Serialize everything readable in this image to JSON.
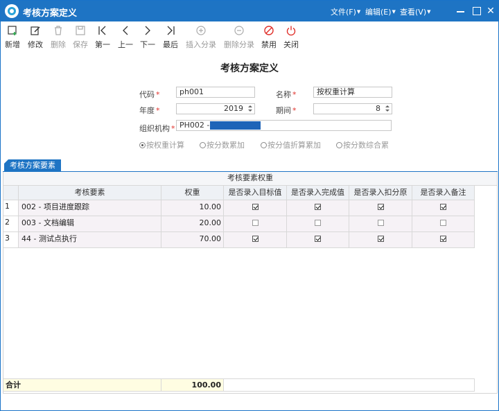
{
  "window": {
    "title": "考核方案定义",
    "menus": [
      {
        "label": "文件(F)"
      },
      {
        "label": "编辑(E)"
      },
      {
        "label": "查看(V)"
      }
    ],
    "minimize_glyph": "—",
    "close_glyph": "✕"
  },
  "toolbar": [
    {
      "label": "新增",
      "icon": "add-icon",
      "enabled": true
    },
    {
      "label": "修改",
      "icon": "edit-icon",
      "enabled": true
    },
    {
      "label": "删除",
      "icon": "trash-icon",
      "enabled": false
    },
    {
      "label": "保存",
      "icon": "save-icon",
      "enabled": false
    },
    {
      "label": "第一",
      "icon": "first-icon",
      "enabled": true
    },
    {
      "label": "上一",
      "icon": "prev-icon",
      "enabled": true
    },
    {
      "label": "下一",
      "icon": "next-icon",
      "enabled": true
    },
    {
      "label": "最后",
      "icon": "last-icon",
      "enabled": true
    },
    {
      "label": "插入分录",
      "icon": "insert-row-icon",
      "enabled": false
    },
    {
      "label": "删除分录",
      "icon": "delete-row-icon",
      "enabled": false
    },
    {
      "label": "禁用",
      "icon": "disable-icon",
      "enabled": true
    },
    {
      "label": "关闭",
      "icon": "power-icon",
      "enabled": true
    }
  ],
  "form": {
    "title": "考核方案定义",
    "code": {
      "label": "代码",
      "value": "ph001"
    },
    "name": {
      "label": "名称",
      "value": "按权重计算"
    },
    "year": {
      "label": "年度",
      "value": "2019"
    },
    "period": {
      "label": "期间",
      "value": "8"
    },
    "org": {
      "label": "组织机构",
      "value": "PH002 -"
    },
    "required_mark": "*",
    "calc_methods": [
      {
        "label": "按权重计算",
        "selected": true
      },
      {
        "label": "按分数累加",
        "selected": false
      },
      {
        "label": "按分值折算累加",
        "selected": false
      },
      {
        "label": "按分数综合累",
        "selected": false
      }
    ]
  },
  "tab": {
    "label": "考核方案要素"
  },
  "grid": {
    "group_header": "考核要素权重",
    "columns": [
      "考核要素",
      "权重",
      "是否录入目标值",
      "是否录入完成值",
      "是否录入扣分原",
      "是否录入备注"
    ],
    "rows": [
      {
        "num": "1",
        "element": "002 - 项目进度跟踪",
        "weight": "10.00",
        "checks": [
          true,
          true,
          true,
          true
        ]
      },
      {
        "num": "2",
        "element": "003 - 文档编辑",
        "weight": "20.00",
        "checks": [
          false,
          false,
          false,
          false
        ]
      },
      {
        "num": "3",
        "element": "44 - 测试点执行",
        "weight": "70.00",
        "checks": [
          true,
          true,
          true,
          true
        ]
      }
    ],
    "total": {
      "label": "合计",
      "weight": "100.00"
    }
  },
  "colors": {
    "titlebar": "#1e74c4",
    "required": "#e0302a",
    "org_highlight": "#1e64b8",
    "total_row": "#fffde2"
  }
}
